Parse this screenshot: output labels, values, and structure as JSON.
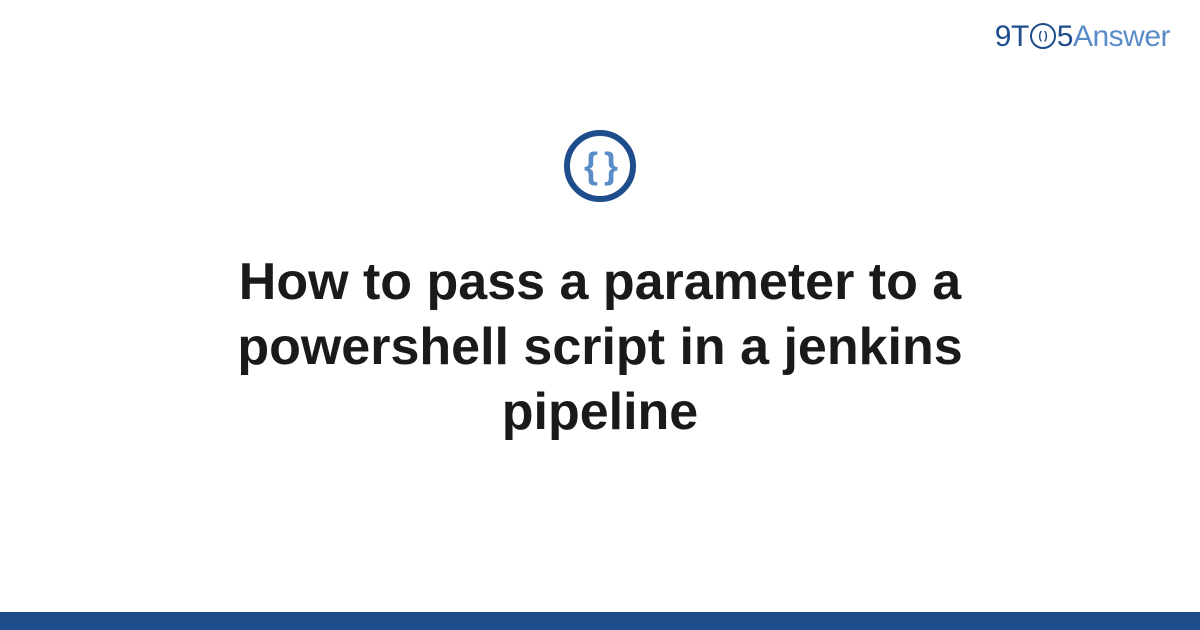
{
  "logo": {
    "part_9": "9",
    "part_t": "T",
    "clock_text": "( )",
    "part_5": "5",
    "part_answer": "Answer"
  },
  "category_icon": {
    "name": "code-braces",
    "symbol": "{ }"
  },
  "title": "How to pass a parameter to a powershell script in a jenkins pipeline",
  "colors": {
    "brand_dark": "#1e4d8b",
    "brand_light": "#5a8dc8",
    "text": "#1a1a1a",
    "background": "#ffffff"
  }
}
